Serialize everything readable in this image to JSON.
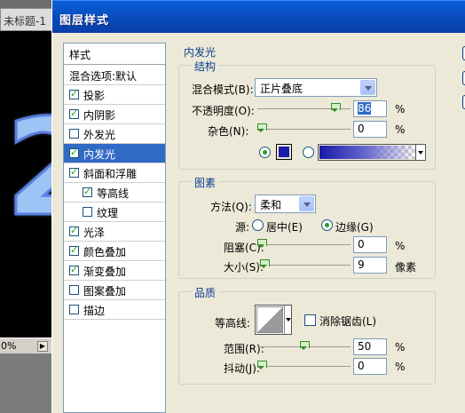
{
  "document_tab": {
    "title": "未标题-1"
  },
  "statusbar": {
    "zoom": "0%"
  },
  "dialog": {
    "title": "图层样式",
    "styles_list": {
      "header": "样式",
      "items": [
        {
          "label": "混合选项:默认",
          "checkbox": false,
          "checked": false,
          "selected": false,
          "indent": 0
        },
        {
          "label": "投影",
          "checkbox": true,
          "checked": true,
          "selected": false,
          "indent": 0
        },
        {
          "label": "内阴影",
          "checkbox": true,
          "checked": true,
          "selected": false,
          "indent": 0
        },
        {
          "label": "外发光",
          "checkbox": true,
          "checked": false,
          "selected": false,
          "indent": 0
        },
        {
          "label": "内发光",
          "checkbox": true,
          "checked": true,
          "selected": true,
          "indent": 0
        },
        {
          "label": "斜面和浮雕",
          "checkbox": true,
          "checked": true,
          "selected": false,
          "indent": 0
        },
        {
          "label": "等高线",
          "checkbox": true,
          "checked": true,
          "selected": false,
          "indent": 1
        },
        {
          "label": "纹理",
          "checkbox": true,
          "checked": false,
          "selected": false,
          "indent": 1
        },
        {
          "label": "光泽",
          "checkbox": true,
          "checked": true,
          "selected": false,
          "indent": 0
        },
        {
          "label": "颜色叠加",
          "checkbox": true,
          "checked": true,
          "selected": false,
          "indent": 0
        },
        {
          "label": "渐变叠加",
          "checkbox": true,
          "checked": true,
          "selected": false,
          "indent": 0
        },
        {
          "label": "图案叠加",
          "checkbox": true,
          "checked": false,
          "selected": false,
          "indent": 0
        },
        {
          "label": "描边",
          "checkbox": true,
          "checked": false,
          "selected": false,
          "indent": 0
        }
      ]
    },
    "panel": {
      "title": "内发光",
      "structure": {
        "title": "结构",
        "blend_mode_label": "混合模式(B):",
        "blend_mode_value": "正片叠底",
        "opacity_label": "不透明度(O):",
        "opacity_value": "86",
        "opacity_level": 0.86,
        "opacity_unit": "%",
        "noise_label": "杂色(N):",
        "noise_value": "0",
        "noise_level": 0,
        "noise_unit": "%",
        "glow_color": "#1c1cad",
        "color_radio_selected": true,
        "gradient_radio_selected": false
      },
      "elements": {
        "title": "图素",
        "method_label": "方法(Q):",
        "method_value": "柔和",
        "source_label": "源:",
        "source_center_label": "居中(E)",
        "source_edge_label": "边缘(G)",
        "source_selected": "edge",
        "choke_label": "阻塞(C):",
        "choke_value": "0",
        "choke_level": 0,
        "choke_unit": "%",
        "size_label": "大小(S):",
        "size_value": "9",
        "size_level": 0.036,
        "size_unit": "像素"
      },
      "quality": {
        "title": "品质",
        "contour_label": "等高线:",
        "antialias_label": "消除锯齿(L)",
        "antialias_checked": false,
        "range_label": "范围(R):",
        "range_value": "50",
        "range_level": 0.5,
        "range_unit": "%",
        "jitter_label": "抖动(J):",
        "jitter_value": "0",
        "jitter_level": 0,
        "jitter_unit": "%"
      }
    }
  }
}
